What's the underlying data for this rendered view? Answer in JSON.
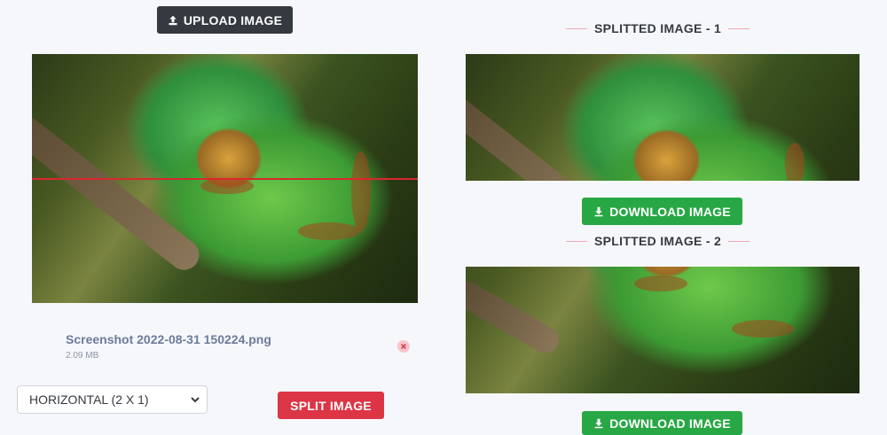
{
  "toolbar": {
    "upload_label": "UPLOAD IMAGE",
    "upload_icon": "upload-icon"
  },
  "source": {
    "image_name": "chameleon-photo",
    "file_name": "Screenshot 2022-08-31 150224.png",
    "file_size": "2.09 MB",
    "remove_icon": "close-icon"
  },
  "controls": {
    "split_mode": "HORIZONTAL (2 X 1)",
    "split_label": "SPLIT IMAGE"
  },
  "results": [
    {
      "title": "SPLITTED IMAGE - 1",
      "download_label": "DOWNLOAD IMAGE",
      "download_icon": "download-icon"
    },
    {
      "title": "SPLITTED IMAGE - 2",
      "download_label": "DOWNLOAD IMAGE",
      "download_icon": "download-icon"
    }
  ],
  "colors": {
    "dark": "#343a40",
    "danger": "#dc3545",
    "success": "#28a745",
    "cut_line": "#d9272e",
    "background": "#f6f7fb"
  }
}
